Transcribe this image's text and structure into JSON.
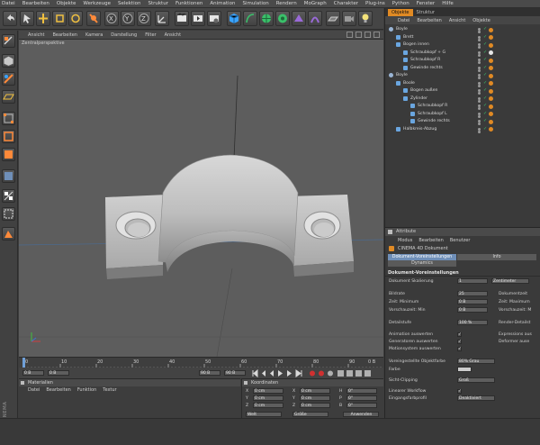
{
  "menubar": [
    "Datei",
    "Bearbeiten",
    "Objekte",
    "Werkzeuge",
    "Selektion",
    "Struktur",
    "Funktionen",
    "Animation",
    "Simulation",
    "Rendern",
    "MoGraph",
    "Charakter",
    "Plug-ins",
    "Python",
    "Fenster",
    "Hilfe"
  ],
  "viewport": {
    "menu": [
      "Ansicht",
      "Bearbeiten",
      "Kamera",
      "Darstellung",
      "Filter",
      "Ansicht"
    ],
    "label": "Zentralperspektive"
  },
  "timeline": {
    "ticks": [
      "0",
      "10",
      "20",
      "30",
      "40",
      "50",
      "60",
      "70",
      "80",
      "90"
    ],
    "end_label": "0 B",
    "current_frame": "0 B",
    "start_field": "0 B",
    "end_field": "90 B",
    "end_field2": "90 B"
  },
  "materials": {
    "title": "Materialien",
    "menu": [
      "Datei",
      "Bearbeiten",
      "Funktion",
      "Textur"
    ]
  },
  "coords": {
    "title": "Koordinaten",
    "rows": [
      {
        "a": "X",
        "av": "0 cm",
        "b": "X",
        "bv": "0 cm",
        "c": "H",
        "cv": "0°"
      },
      {
        "a": "Y",
        "av": "0 cm",
        "b": "Y",
        "bv": "0 cm",
        "c": "P",
        "cv": "0°"
      },
      {
        "a": "Z",
        "av": "0 cm",
        "b": "Z",
        "bv": "0 cm",
        "c": "B",
        "cv": "0°"
      }
    ],
    "mode_select": "Welt",
    "size_select": "Größe",
    "apply_button": "Anwenden"
  },
  "brand": "MAXON CINEMA 4D",
  "object_manager": {
    "tabs": [
      "Objekte",
      "Struktur"
    ],
    "menu": [
      "Datei",
      "Bearbeiten",
      "Ansicht",
      "Objekte"
    ],
    "rows": [
      {
        "name": "Boyle",
        "indent": 0,
        "type": "null"
      },
      {
        "name": "Brett",
        "indent": 1,
        "type": "obj"
      },
      {
        "name": "Bogen innen",
        "indent": 1,
        "type": "obj"
      },
      {
        "name": "Schraubkopf + G",
        "indent": 2,
        "type": "obj"
      },
      {
        "name": "Schraubkopf R",
        "indent": 2,
        "type": "obj"
      },
      {
        "name": "Gewinde rechts",
        "indent": 2,
        "type": "obj"
      },
      {
        "name": "Boyle",
        "indent": 0,
        "type": "null"
      },
      {
        "name": "Boole",
        "indent": 1,
        "type": "obj"
      },
      {
        "name": "Bogen außen",
        "indent": 2,
        "type": "obj"
      },
      {
        "name": "Zylinder",
        "indent": 2,
        "type": "obj"
      },
      {
        "name": "Schraubkopf R",
        "indent": 3,
        "type": "obj"
      },
      {
        "name": "Schraubkopf L",
        "indent": 3,
        "type": "obj"
      },
      {
        "name": "Gewinde rechts",
        "indent": 3,
        "type": "obj"
      },
      {
        "name": "Halbkreis-Abzug",
        "indent": 1,
        "type": "obj"
      }
    ]
  },
  "attributes": {
    "title": "Attribute",
    "menu": [
      "Modus",
      "Bearbeiten",
      "Benutzer"
    ],
    "doc_label": "CINEMA 4D Dokument",
    "tabs": [
      "Dokument-Voreinstellungen",
      "Info",
      "Dynamics"
    ],
    "section": "Dokument-Voreinstellungen",
    "scale_label": "Dokument Skalierung",
    "scale_value": "1",
    "scale_unit": "Zentimeter",
    "fps_label": "Bildrate",
    "fps_value": "25",
    "min_label": "Zeit: Minimum",
    "min_value": "0 B",
    "prev_min_label": "Vorschauzeit: Min",
    "prev_min_value": "0 B",
    "lod_label": "Detailstufe",
    "lod_value": "100 %",
    "anim_label": "Animation auswerten",
    "gen_label": "Generatoren auswerten",
    "motion_label": "Motionsystem auswerten",
    "r_doc_time": "Dokumentzeit",
    "r_max": "Zeit: Maximum",
    "r_prev_max": "Vorschauzeit: M",
    "r_render_lod": "Render-Detailst",
    "r_expr": "Expressions aus",
    "r_deform": "Deformer ause",
    "obj_color_label": "Voreingestellte Objektfarbe",
    "obj_color_value": "80% Grau",
    "color_label": "Farbe",
    "clip_label": "Sicht-Clipping",
    "clip_value": "Groß",
    "linear_label": "Linearer Workflow",
    "profile_label": "Eingangsfarbprofil",
    "profile_value": "Deaktiviert"
  },
  "accent": "#e08a24"
}
